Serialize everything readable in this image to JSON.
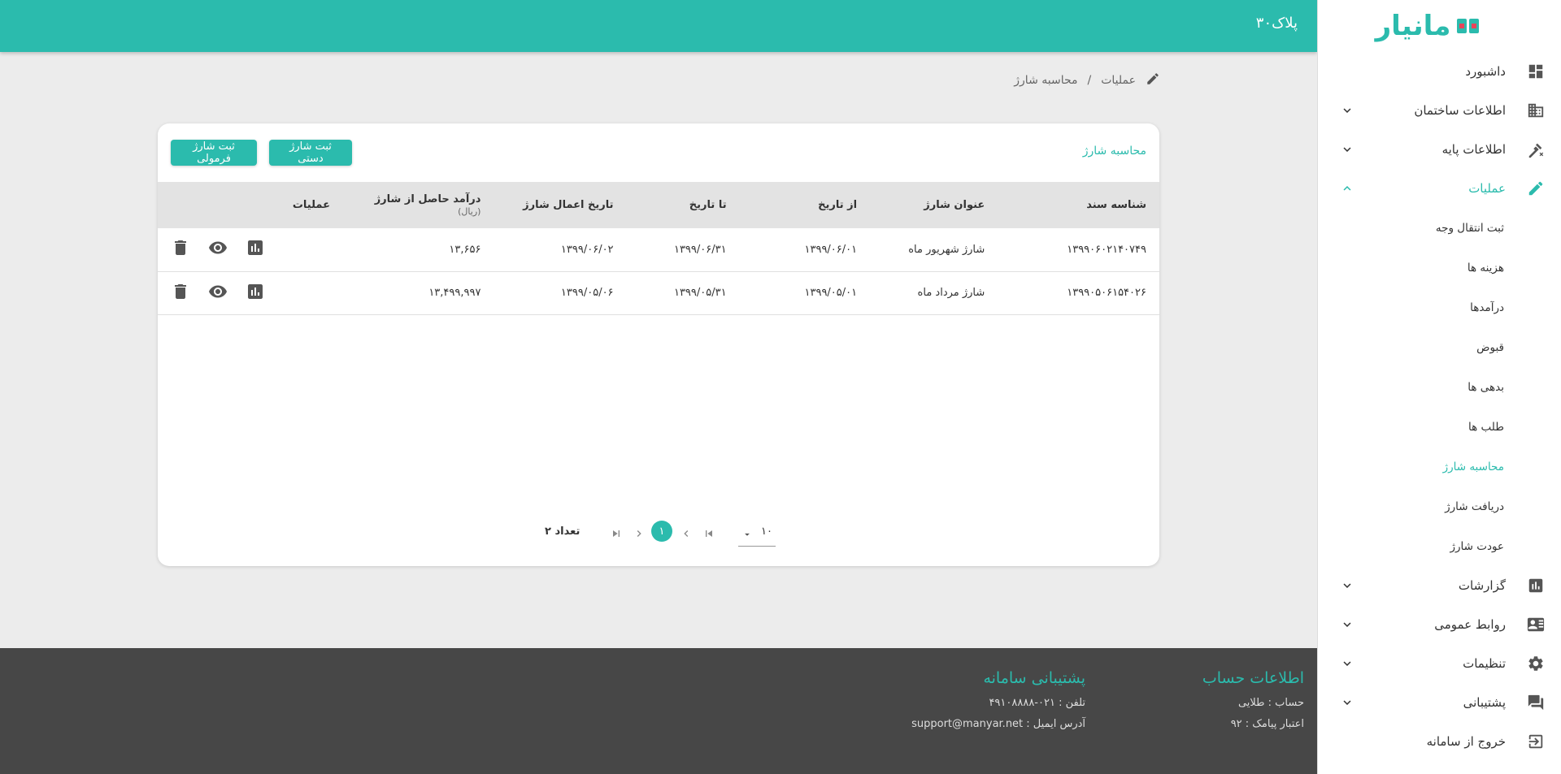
{
  "header": {
    "unit_title": "پلاک۳۰"
  },
  "brand": {
    "logo_text": "مانیار",
    "accent": "#2bbbad",
    "logo_accent": "#e8445a"
  },
  "sidebar": {
    "items": [
      {
        "label": "داشبورد",
        "icon": "dashboard-icon"
      },
      {
        "label": "اطلاعات ساختمان",
        "icon": "building-icon"
      },
      {
        "label": "اطلاعات پایه",
        "icon": "base-info-icon"
      },
      {
        "label": "عملیات",
        "icon": "edit-pencil-icon"
      },
      {
        "label": "گزارشات",
        "icon": "bar-chart-icon"
      },
      {
        "label": "روابط عمومی",
        "icon": "contact-card-icon"
      },
      {
        "label": "تنظیمات",
        "icon": "gear-icon"
      },
      {
        "label": "پشتیبانی",
        "icon": "chat-icon"
      },
      {
        "label": "خروج از سامانه",
        "icon": "logout-icon"
      }
    ],
    "operations_sub": [
      "ثبت انتقال وجه",
      "هزینه ها",
      "درآمدها",
      "قبوض",
      "بدهی ها",
      "طلب ها",
      "محاسبه شارژ",
      "دریافت شارژ",
      "عودت شارژ"
    ]
  },
  "breadcrumb": {
    "parent": "عملیات",
    "separator": "/",
    "current": "محاسبه شارژ"
  },
  "card": {
    "title": "محاسبه شارژ",
    "btn_manual": "ثبت شارژ دستی",
    "btn_formula": "ثبت شارژ فرمولی"
  },
  "table": {
    "headers": {
      "doc_id": "شناسه سند",
      "title": "عنوان شارژ",
      "from": "از تاریخ",
      "to": "تا تاریخ",
      "apply": "تاریخ اعمال شارژ",
      "income": "درآمد حاصل از شارژ",
      "income_unit": "(ریال)",
      "ops": "عملیات"
    },
    "rows": [
      {
        "doc_id": "۱۳۹۹۰۶۰۲۱۴۰۷۴۹",
        "title": "شارژ شهریور ماه",
        "from": "۱۳۹۹/۰۶/۰۱",
        "to": "۱۳۹۹/۰۶/۳۱",
        "apply": "۱۳۹۹/۰۶/۰۲",
        "income": "۱۳,۶۵۶"
      },
      {
        "doc_id": "۱۳۹۹۰۵۰۶۱۵۴۰۲۶",
        "title": "شارژ مرداد ماه",
        "from": "۱۳۹۹/۰۵/۰۱",
        "to": "۱۳۹۹/۰۵/۳۱",
        "apply": "۱۳۹۹/۰۵/۰۶",
        "income": "۱۳,۴۹۹,۹۹۷"
      }
    ]
  },
  "pagination": {
    "count_label": "تعداد ۲",
    "current_page": "۱",
    "page_size": "۱۰"
  },
  "footer": {
    "account_title": "اطلاعات حساب",
    "account_line1": "حساب : طلایی",
    "account_line2": "اعتبار پیامک : ۹۲",
    "support_title": "پشتیبانی سامانه",
    "support_phone": "تلفن : ۰۲۱-۴۹۱۰۸۸۸۸",
    "support_email": "آدرس ایمیل : support@manyar.net"
  }
}
